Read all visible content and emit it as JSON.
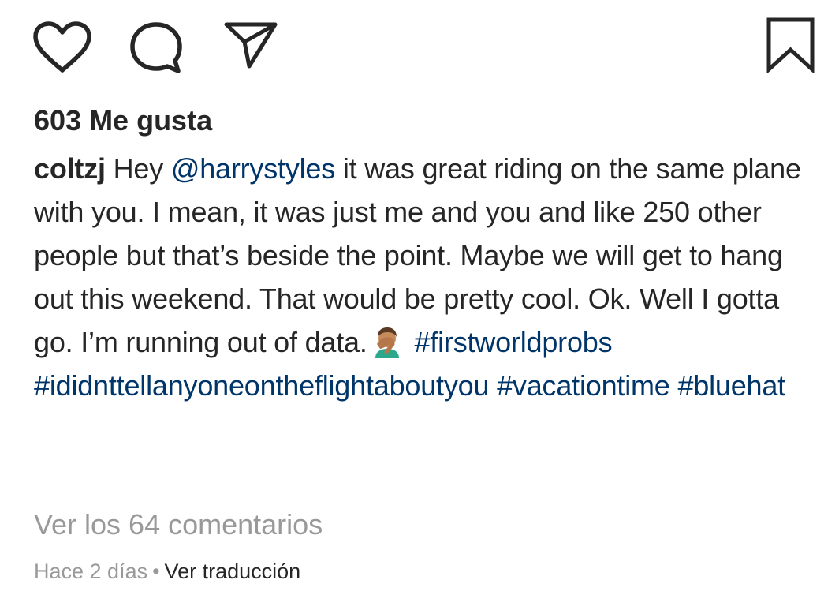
{
  "actions": {
    "like_icon": "heart-icon",
    "comment_icon": "comment-icon",
    "share_icon": "paper-plane-icon",
    "save_icon": "bookmark-icon"
  },
  "likes": {
    "label": "603 Me gusta"
  },
  "caption": {
    "username": "coltzj",
    "text_before_mention": "Hey",
    "mention": "@harrystyles",
    "text_after_mention": "it was great riding on the same plane with you. I mean, it was just me and you and like 250 other people but that’s beside the point. Maybe we will get to hang out this weekend. That would be pretty cool. Ok. Well I gotta go. I’m running out of data.",
    "emoji": "facepalm-emoji",
    "hashtags": [
      "#firstworldprobs",
      "#ididnttellanyoneontheflightaboutyou",
      "#vacationtime",
      "#bluehat"
    ]
  },
  "comments": {
    "view_all_label": "Ver los 64 comentarios"
  },
  "meta": {
    "time_ago": "Hace 2 días",
    "separator": "•",
    "translate_label": "Ver traducción"
  },
  "colors": {
    "text": "#262626",
    "link": "#003569",
    "muted": "#999999"
  }
}
